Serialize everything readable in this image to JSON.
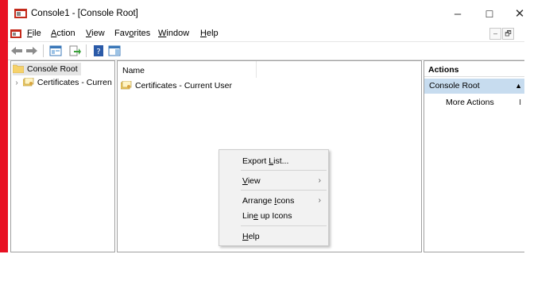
{
  "window": {
    "title": "Console1 - [Console Root]",
    "minimize_glyph": "–",
    "maximize_glyph": "☐",
    "close_glyph": "✕"
  },
  "menubar": {
    "file_underlined": "F",
    "file_rest": "ile",
    "action_underlined": "A",
    "action_rest": "ction",
    "view_underlined": "V",
    "view_rest": "iew",
    "favorites_pre": "Fav",
    "favorites_underlined": "o",
    "favorites_rest": "rites",
    "window_underlined": "W",
    "window_rest": "indow",
    "help_underlined": "H",
    "help_rest": "elp",
    "mdi_minimize": "–",
    "mdi_restore": "🗗"
  },
  "toolbar": {
    "icons": [
      "back-arrow-icon",
      "forward-arrow-icon",
      "show-hide-tree-icon",
      "export-list-icon",
      "help-icon",
      "show-hide-action-pane-icon"
    ]
  },
  "tree": {
    "root_label": "Console Root",
    "child_label": "Certificates - Curren",
    "chevron": "›"
  },
  "list": {
    "column_name": "Name",
    "items": [
      "Certificates - Current User"
    ]
  },
  "actions": {
    "header": "Actions",
    "selected": "Console Root",
    "selected_arrow": "▲",
    "item": "More Actions",
    "right_fragment": "I"
  },
  "context_menu": {
    "export_pre": "Export ",
    "export_underlined": "L",
    "export_rest": "ist...",
    "view_underlined": "V",
    "view_rest": "iew",
    "arrange_pre": "Arrange ",
    "arrange_underlined": "I",
    "arrange_rest": "cons",
    "lineup_pre": "Lin",
    "lineup_underlined": "e",
    "lineup_rest": " up Icons",
    "help_underlined": "H",
    "help_rest": "elp",
    "submenu_arrow": "›"
  },
  "colors": {
    "accent_red": "#e81123",
    "selection_blue": "#c7dcef",
    "tree_selection": "#e5e5e5",
    "menu_bg": "#f2f2f2"
  }
}
